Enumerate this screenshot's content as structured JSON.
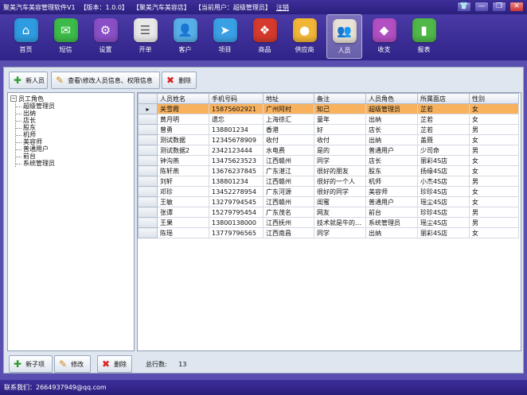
{
  "window": {
    "title_segments": [
      "聚美汽车美容管理软件V1",
      "【版本：1.0.0】",
      "【聚美汽车美容店】",
      "【当前用户：超级管理员】"
    ],
    "logout_label": "注销",
    "controls": {
      "skin": "👕",
      "minimize": "—",
      "maximize": "❐",
      "close": "✕"
    }
  },
  "nav": {
    "items": [
      {
        "label": "首页",
        "icon": "home-icon",
        "glyph": "⌂",
        "color": "#2f9be0"
      },
      {
        "label": "短信",
        "icon": "message-icon",
        "glyph": "✉",
        "color": "#3dbb48"
      },
      {
        "label": "设置",
        "icon": "gear-icon",
        "glyph": "⚙",
        "color": "#8a4fc6"
      },
      {
        "label": "开单",
        "icon": "order-icon",
        "glyph": "☰",
        "color": "#e9e9e9"
      },
      {
        "label": "客户",
        "icon": "customer-icon",
        "glyph": "👤",
        "color": "#57aee8"
      },
      {
        "label": "项目",
        "icon": "project-icon",
        "glyph": "➤",
        "color": "#3aa0e6"
      },
      {
        "label": "商品",
        "icon": "goods-icon",
        "glyph": "❖",
        "color": "#d53a2c"
      },
      {
        "label": "供应商",
        "icon": "supplier-icon",
        "glyph": "●",
        "color": "#f2b637"
      },
      {
        "label": "人员",
        "icon": "staff-icon",
        "glyph": "👥",
        "color": "#e9e2d6"
      },
      {
        "label": "收支",
        "icon": "finance-icon",
        "glyph": "◆",
        "color": "#b24fc2"
      },
      {
        "label": "报表",
        "icon": "report-icon",
        "glyph": "▮",
        "color": "#4fb848"
      }
    ],
    "active_index": 8
  },
  "toolbar": {
    "add_label": "新人员",
    "edit_label": "查看\\修改人员信息、权限信息",
    "delete_label": "删除"
  },
  "tree": {
    "root_label": "员工角色",
    "children": [
      "超级管理员",
      "出纳",
      "店长",
      "股东",
      "机师",
      "美容师",
      "普通用户",
      "前台",
      "系统管理员"
    ]
  },
  "grid": {
    "columns": [
      "人员姓名",
      "手机号码",
      "地址",
      "备注",
      "人员角色",
      "所属面店",
      "性别"
    ],
    "selected_row": 0,
    "row_marker": "▸",
    "rows": [
      [
        "关雪霞",
        "15875602921",
        "广州阿村",
        "知己",
        "超级管理员",
        "芷若",
        "女"
      ],
      [
        "黄月明",
        "遗忘",
        "上海徐汇",
        "童年",
        "出纳",
        "芷若",
        "女"
      ],
      [
        "曾勇",
        "138801234",
        "香港",
        "好",
        "店长",
        "芷若",
        "男"
      ],
      [
        "测试数据",
        "12345678909",
        "收付",
        "收付",
        "出纳",
        "盖聂",
        "女"
      ],
      [
        "测试数据2",
        "2342123444",
        "水电费",
        "是的",
        "普通用户",
        "少司命",
        "男"
      ],
      [
        "钟沟燕",
        "13475623523",
        "江西赣州",
        "同学",
        "店长",
        "丽彩4S店",
        "女"
      ],
      [
        "陈轩燕",
        "13676237845",
        "广东湛江",
        "很好的朋友",
        "股东",
        "扬缘4S店",
        "女"
      ],
      [
        "刘轩",
        "138801234",
        "江西赣州",
        "很好的一个人",
        "机师",
        "小杰4S店",
        "男"
      ],
      [
        "邓珍",
        "13452278954",
        "广东河源",
        "很好的同学",
        "美容师",
        "珍珍4S店",
        "女"
      ],
      [
        "王敏",
        "13279794545",
        "江西赣州",
        "闺蜜",
        "普通用户",
        "瑶尘4S店",
        "女"
      ],
      [
        "张谭",
        "15279795454",
        "广东茂名",
        "网友",
        "前台",
        "珍珍4S店",
        "男"
      ],
      [
        "王果",
        "13800138000",
        "江西抚州",
        "技术就是牛的…",
        "系统管理员",
        "瑶尘4S店",
        "男"
      ],
      [
        "陈瑶",
        "13779796565",
        "江西南昌",
        "同学",
        "出纳",
        "丽彩4S店",
        "女"
      ]
    ]
  },
  "bottom": {
    "add_child_label": "新子项",
    "edit_label": "修改",
    "delete_label": "删除",
    "total_label": "总行数:",
    "total_count": "13"
  },
  "status": {
    "contact": "联系我们：2664937949@qq.com"
  }
}
